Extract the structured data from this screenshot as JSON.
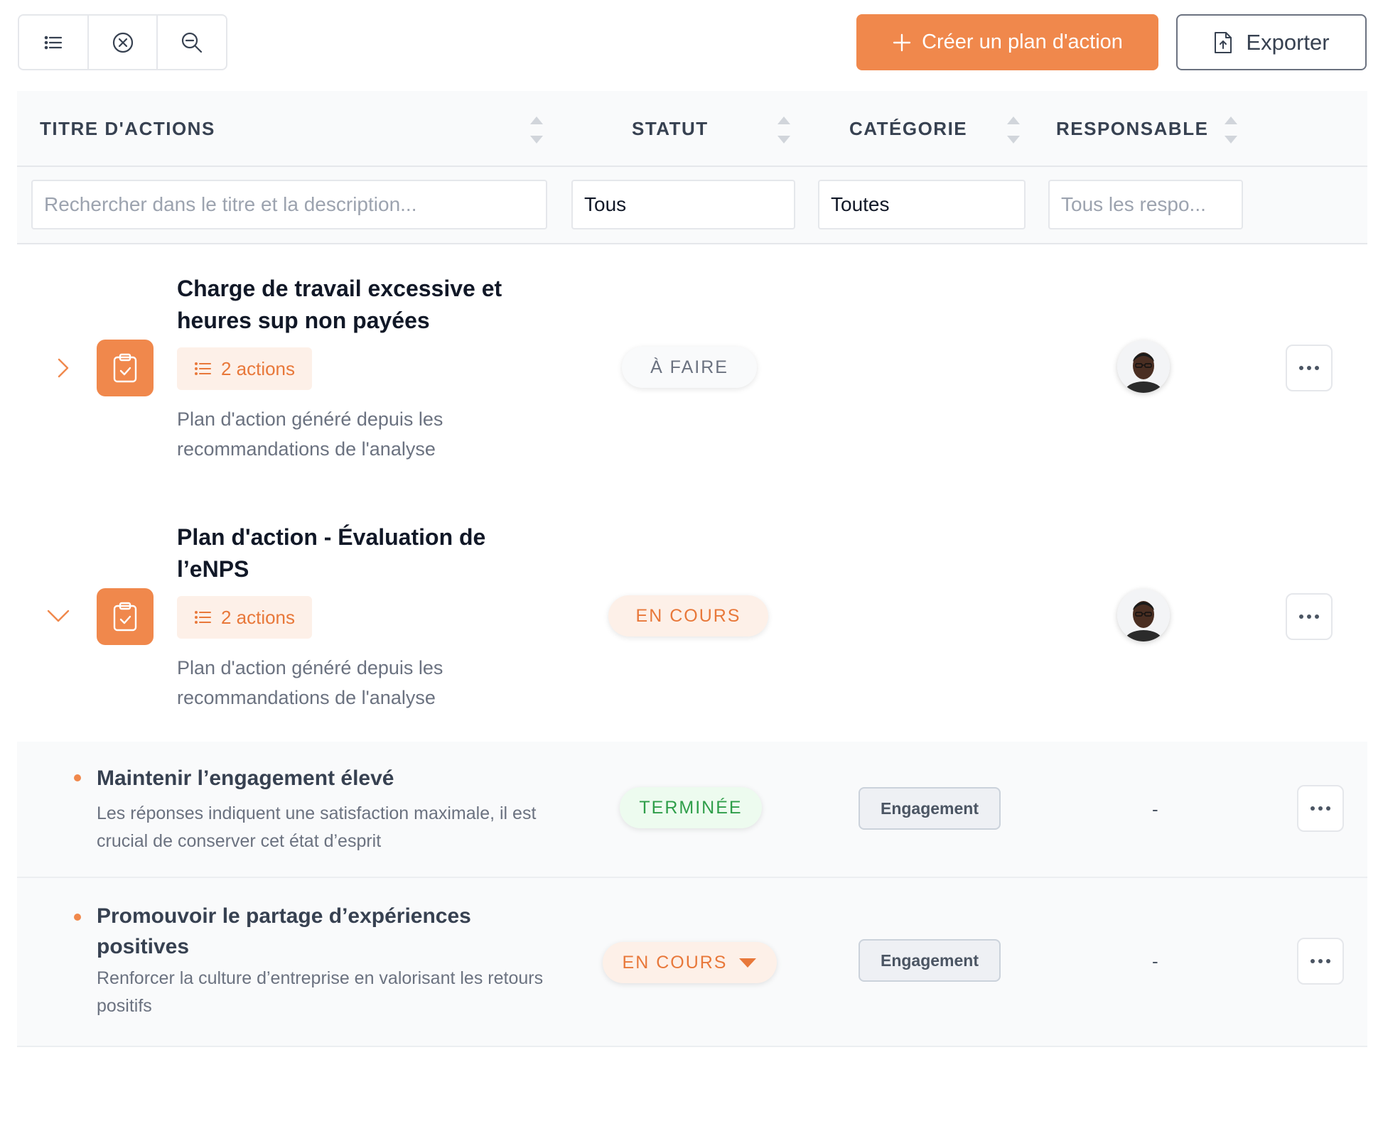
{
  "toolbar": {
    "icons": [
      "list-icon",
      "clear-filter-icon",
      "zoom-out-icon"
    ],
    "create_label": "Créer un plan d'action",
    "export_label": "Exporter"
  },
  "columns": {
    "title": "TITRE D'ACTIONS",
    "status": "STATUT",
    "category": "CATÉGORIE",
    "owner": "RESPONSABLE"
  },
  "filters": {
    "search_placeholder": "Rechercher dans le titre et la description...",
    "status_value": "Tous",
    "category_value": "Toutes",
    "owner_placeholder": "Tous les respo..."
  },
  "plans": [
    {
      "title": "Charge de travail excessive et heures sup non payées",
      "actions_label": "2 actions",
      "description": "Plan d'action généré depuis les recommandations de l'analyse",
      "status": "À FAIRE",
      "expanded": false
    },
    {
      "title": "Plan d'action - Évaluation de l’eNPS",
      "actions_label": "2 actions",
      "description": "Plan d'action généré depuis les recommandations de l'analyse",
      "status": "EN COURS",
      "expanded": true
    }
  ],
  "actions": [
    {
      "title": "Maintenir l’engagement élevé",
      "description": "Les réponses indiquent une satisfaction maximale, il est crucial de conserver cet état d’esprit",
      "status": "TERMINÉE",
      "category": "Engagement",
      "owner": "-"
    },
    {
      "title": "Promouvoir le partage d’expériences positives",
      "description": "Renforcer la culture d’entreprise en valorisant les retours positifs",
      "status": "EN COURS",
      "category": "Engagement",
      "owner": "-"
    }
  ],
  "colors": {
    "accent": "#f0884c",
    "done": "#2f9e4a",
    "muted": "#6b7280"
  }
}
